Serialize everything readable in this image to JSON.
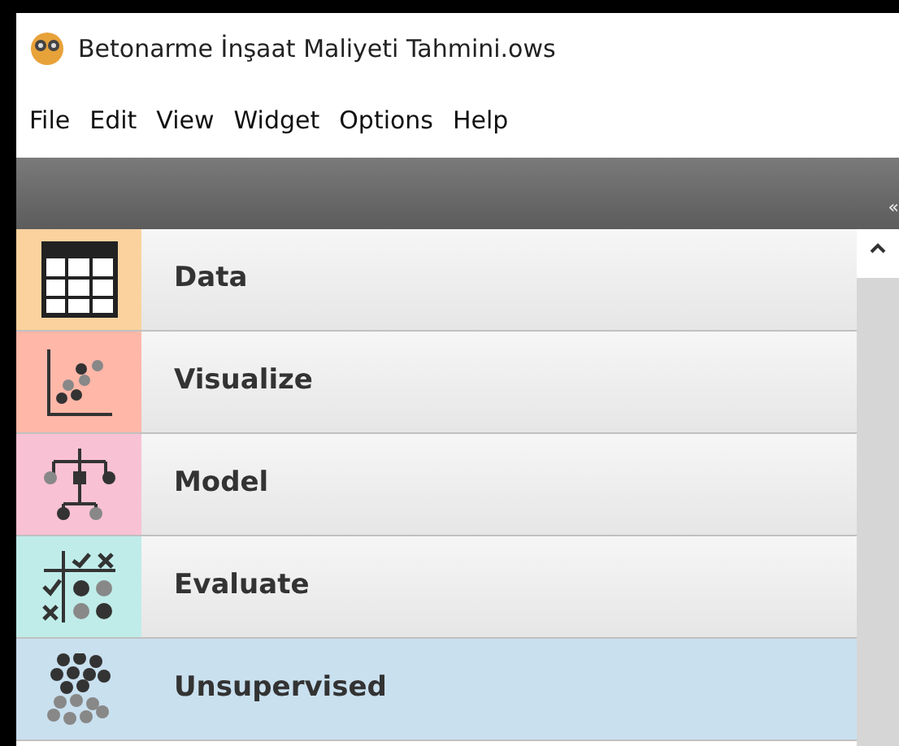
{
  "window": {
    "title": "Betonarme İnşaat Maliyeti Tahmini.ows"
  },
  "menu": [
    "File",
    "Edit",
    "View",
    "Widget",
    "Options",
    "Help"
  ],
  "toolbar": {
    "collapse": "«"
  },
  "categories": [
    {
      "kind": "table",
      "label": "Data",
      "color": "#fbd29e",
      "selected": false
    },
    {
      "kind": "scatter",
      "label": "Visualize",
      "color": "#ffb7a8",
      "selected": false
    },
    {
      "kind": "tree",
      "label": "Model",
      "color": "#f9c1d4",
      "selected": false
    },
    {
      "kind": "matrix",
      "label": "Evaluate",
      "color": "#bfece9",
      "selected": false
    },
    {
      "kind": "cluster",
      "label": "Unsupervised",
      "color": "#c9e0ef",
      "selected": true
    }
  ]
}
